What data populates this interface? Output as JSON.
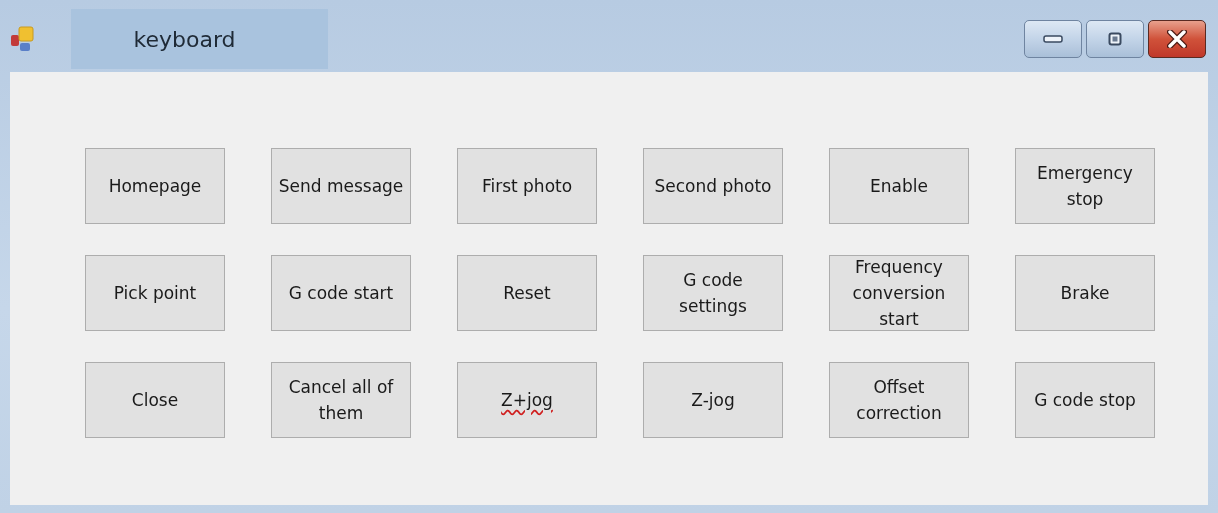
{
  "window": {
    "title": "keyboard"
  },
  "buttons": [
    {
      "label": "Homepage",
      "misspelled": false
    },
    {
      "label": "Send message",
      "misspelled": false
    },
    {
      "label": "First photo",
      "misspelled": false
    },
    {
      "label": "Second photo",
      "misspelled": false
    },
    {
      "label": "Enable",
      "misspelled": false
    },
    {
      "label": "Emergency stop",
      "misspelled": false
    },
    {
      "label": "Pick point",
      "misspelled": false
    },
    {
      "label": "G code start",
      "misspelled": false
    },
    {
      "label": "Reset",
      "misspelled": false
    },
    {
      "label": "G code settings",
      "misspelled": false
    },
    {
      "label": "Frequency conversion start",
      "misspelled": false
    },
    {
      "label": "Brake",
      "misspelled": false
    },
    {
      "label": "Close",
      "misspelled": false
    },
    {
      "label": "Cancel all of them",
      "misspelled": false
    },
    {
      "label": "Z+jog",
      "misspelled": true
    },
    {
      "label": "Z-jog",
      "misspelled": false
    },
    {
      "label": "Offset correction",
      "misspelled": false
    },
    {
      "label": "G code stop",
      "misspelled": false
    }
  ]
}
